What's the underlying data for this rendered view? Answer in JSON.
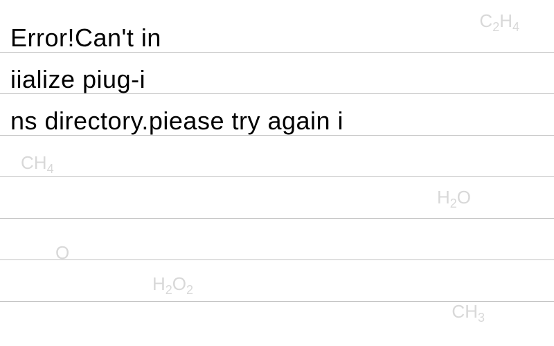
{
  "text": {
    "line1": "Error!Can't in",
    "line2": "iialize piug-i",
    "line3": "ns directory.piease try again i"
  },
  "watermarks": {
    "formula1": "C₂H₄",
    "formula2": "CH₄",
    "formula3": "H₂O",
    "formula4": "H₂O₂",
    "formula5": "CH₃",
    "formula6": "O"
  }
}
